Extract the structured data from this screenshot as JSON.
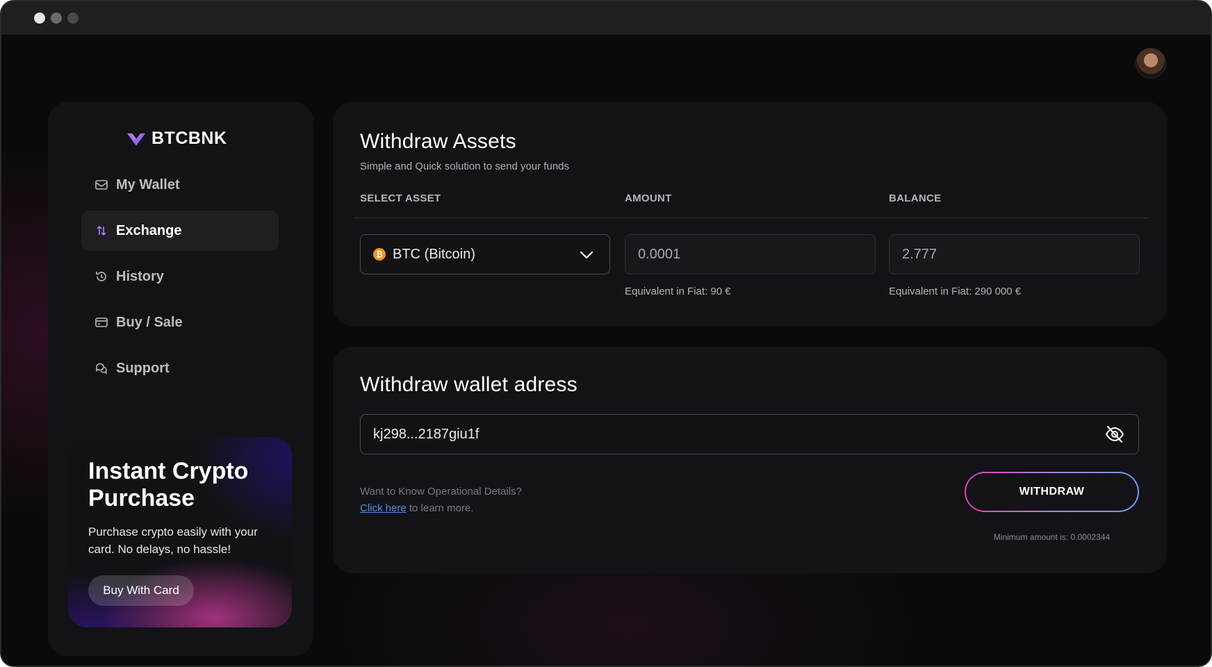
{
  "app": {
    "brand": "BTCBNK"
  },
  "sidebar": {
    "items": [
      {
        "label": "My Wallet",
        "icon": "wallet-icon"
      },
      {
        "label": "Exchange",
        "icon": "exchange-icon",
        "active": true
      },
      {
        "label": "History",
        "icon": "history-icon"
      },
      {
        "label": "Buy / Sale",
        "icon": "card-icon"
      },
      {
        "label": "Support",
        "icon": "support-icon"
      }
    ],
    "promo": {
      "title": "Instant Crypto Purchase",
      "text": "Purchase crypto easily with your card. No delays, no hassle!",
      "button": "Buy With Card"
    }
  },
  "withdraw": {
    "title": "Withdraw Assets",
    "subtitle": "Simple and Quick solution to send your funds",
    "labels": {
      "asset": "SELECT ASSET",
      "amount": "AMOUNT",
      "balance": "BALANCE"
    },
    "asset_value": "BTC (Bitcoin)",
    "asset_icon_glyph": "₿",
    "amount_value": "0.0001",
    "amount_fiat": "Equivalent in Fiat: 90 €",
    "balance_value": "2.777",
    "balance_fiat": "Equivalent in Fiat: 290 000 €"
  },
  "wallet": {
    "title": "Withdraw wallet adress",
    "address_value": "kj298...2187giu1f",
    "info_question": "Want to Know Operational Details?",
    "info_link": "Click here",
    "info_suffix": " to learn more.",
    "button": "WITHDRAW",
    "minimum": "Minimum amount is: 0.0002344"
  },
  "colors": {
    "accent_start": "#e63fb0",
    "accent_end": "#6d9dfa",
    "btc": "#f7931a",
    "link": "#4d8ff0"
  }
}
